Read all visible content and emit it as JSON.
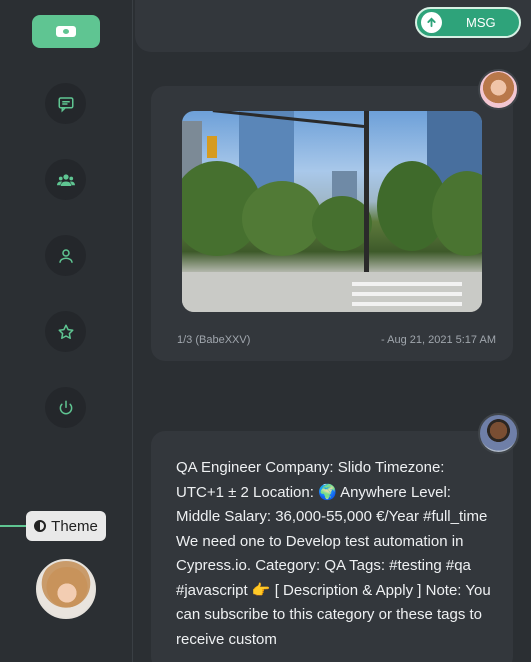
{
  "sidebar": {
    "nav": [
      "logo-icon",
      "chat-icon",
      "group-icon",
      "user-icon",
      "star-icon",
      "power-icon"
    ],
    "theme_label": "Theme"
  },
  "header": {
    "msg_label": "MSG"
  },
  "posts": [
    {
      "counter": "1/3 (BabeXXV)",
      "timestamp": "- Aug 21, 2021 5:17 AM"
    },
    {
      "text": "QA Engineer Company: Slido Timezone: UTC+1 ± 2 Location: 🌍 Anywhere Level: Middle Salary: 36,000-55,000 €/Year #full_time We need one to Develop test automation in Cypress.io. Category: QA Tags: #testing #qa #javascript 👉 [ Description & Apply ] Note: You can subscribe to this category or these tags to receive custom"
    }
  ],
  "colors": {
    "accent": "#5fc592",
    "msg_button": "#2ea37a",
    "background": "#2b2f33",
    "card": "#33373c"
  }
}
